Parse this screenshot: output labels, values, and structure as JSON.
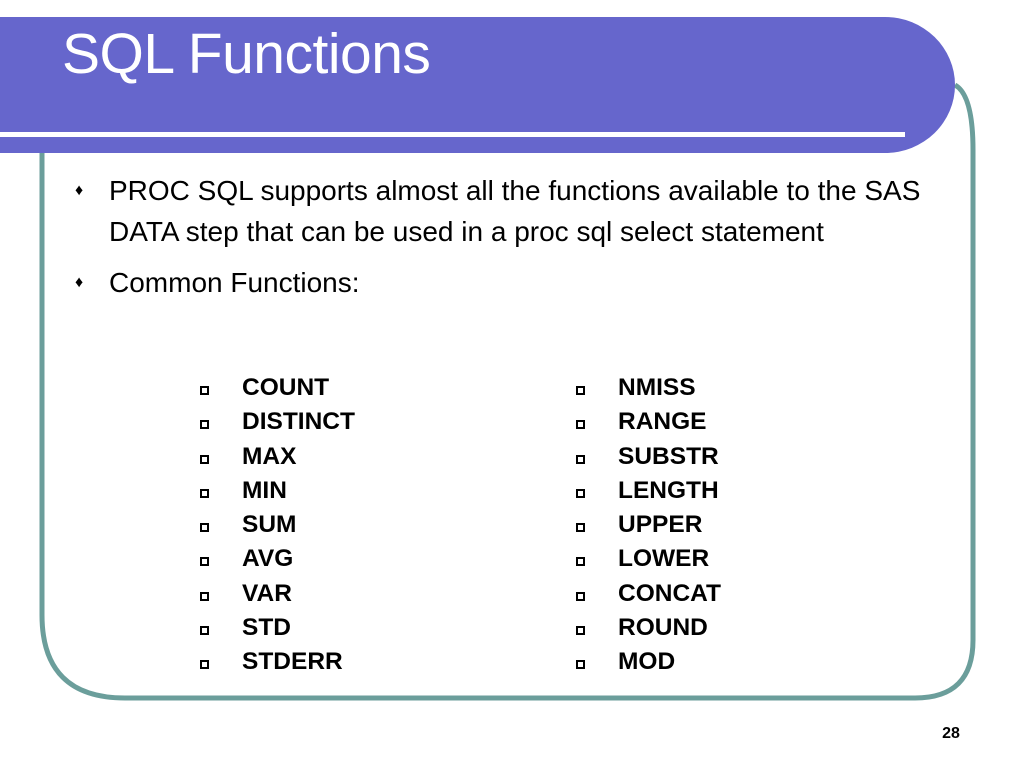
{
  "slide": {
    "title": "SQL Functions",
    "colors": {
      "header": "#6666cc",
      "header_rule": "#ffffff",
      "frame_border": "#6b9e9b",
      "text": "#000000"
    },
    "bullets": [
      {
        "icon": "diamond-bullet-icon",
        "marker": "♦",
        "text": "PROC SQL supports almost all the functions available to the SAS DATA step that can be used in a proc sql select statement"
      },
      {
        "icon": "diamond-bullet-icon",
        "marker": "♦",
        "text": "Common Functions:"
      }
    ],
    "functions": {
      "left": [
        "COUNT",
        "DISTINCT",
        "MAX",
        "MIN",
        "SUM",
        "AVG",
        "VAR",
        "STD",
        "STDERR"
      ],
      "right": [
        "NMISS",
        "RANGE",
        "SUBSTR",
        "LENGTH",
        "UPPER",
        "LOWER",
        "CONCAT",
        "ROUND",
        "MOD"
      ]
    },
    "page_number": "28"
  }
}
